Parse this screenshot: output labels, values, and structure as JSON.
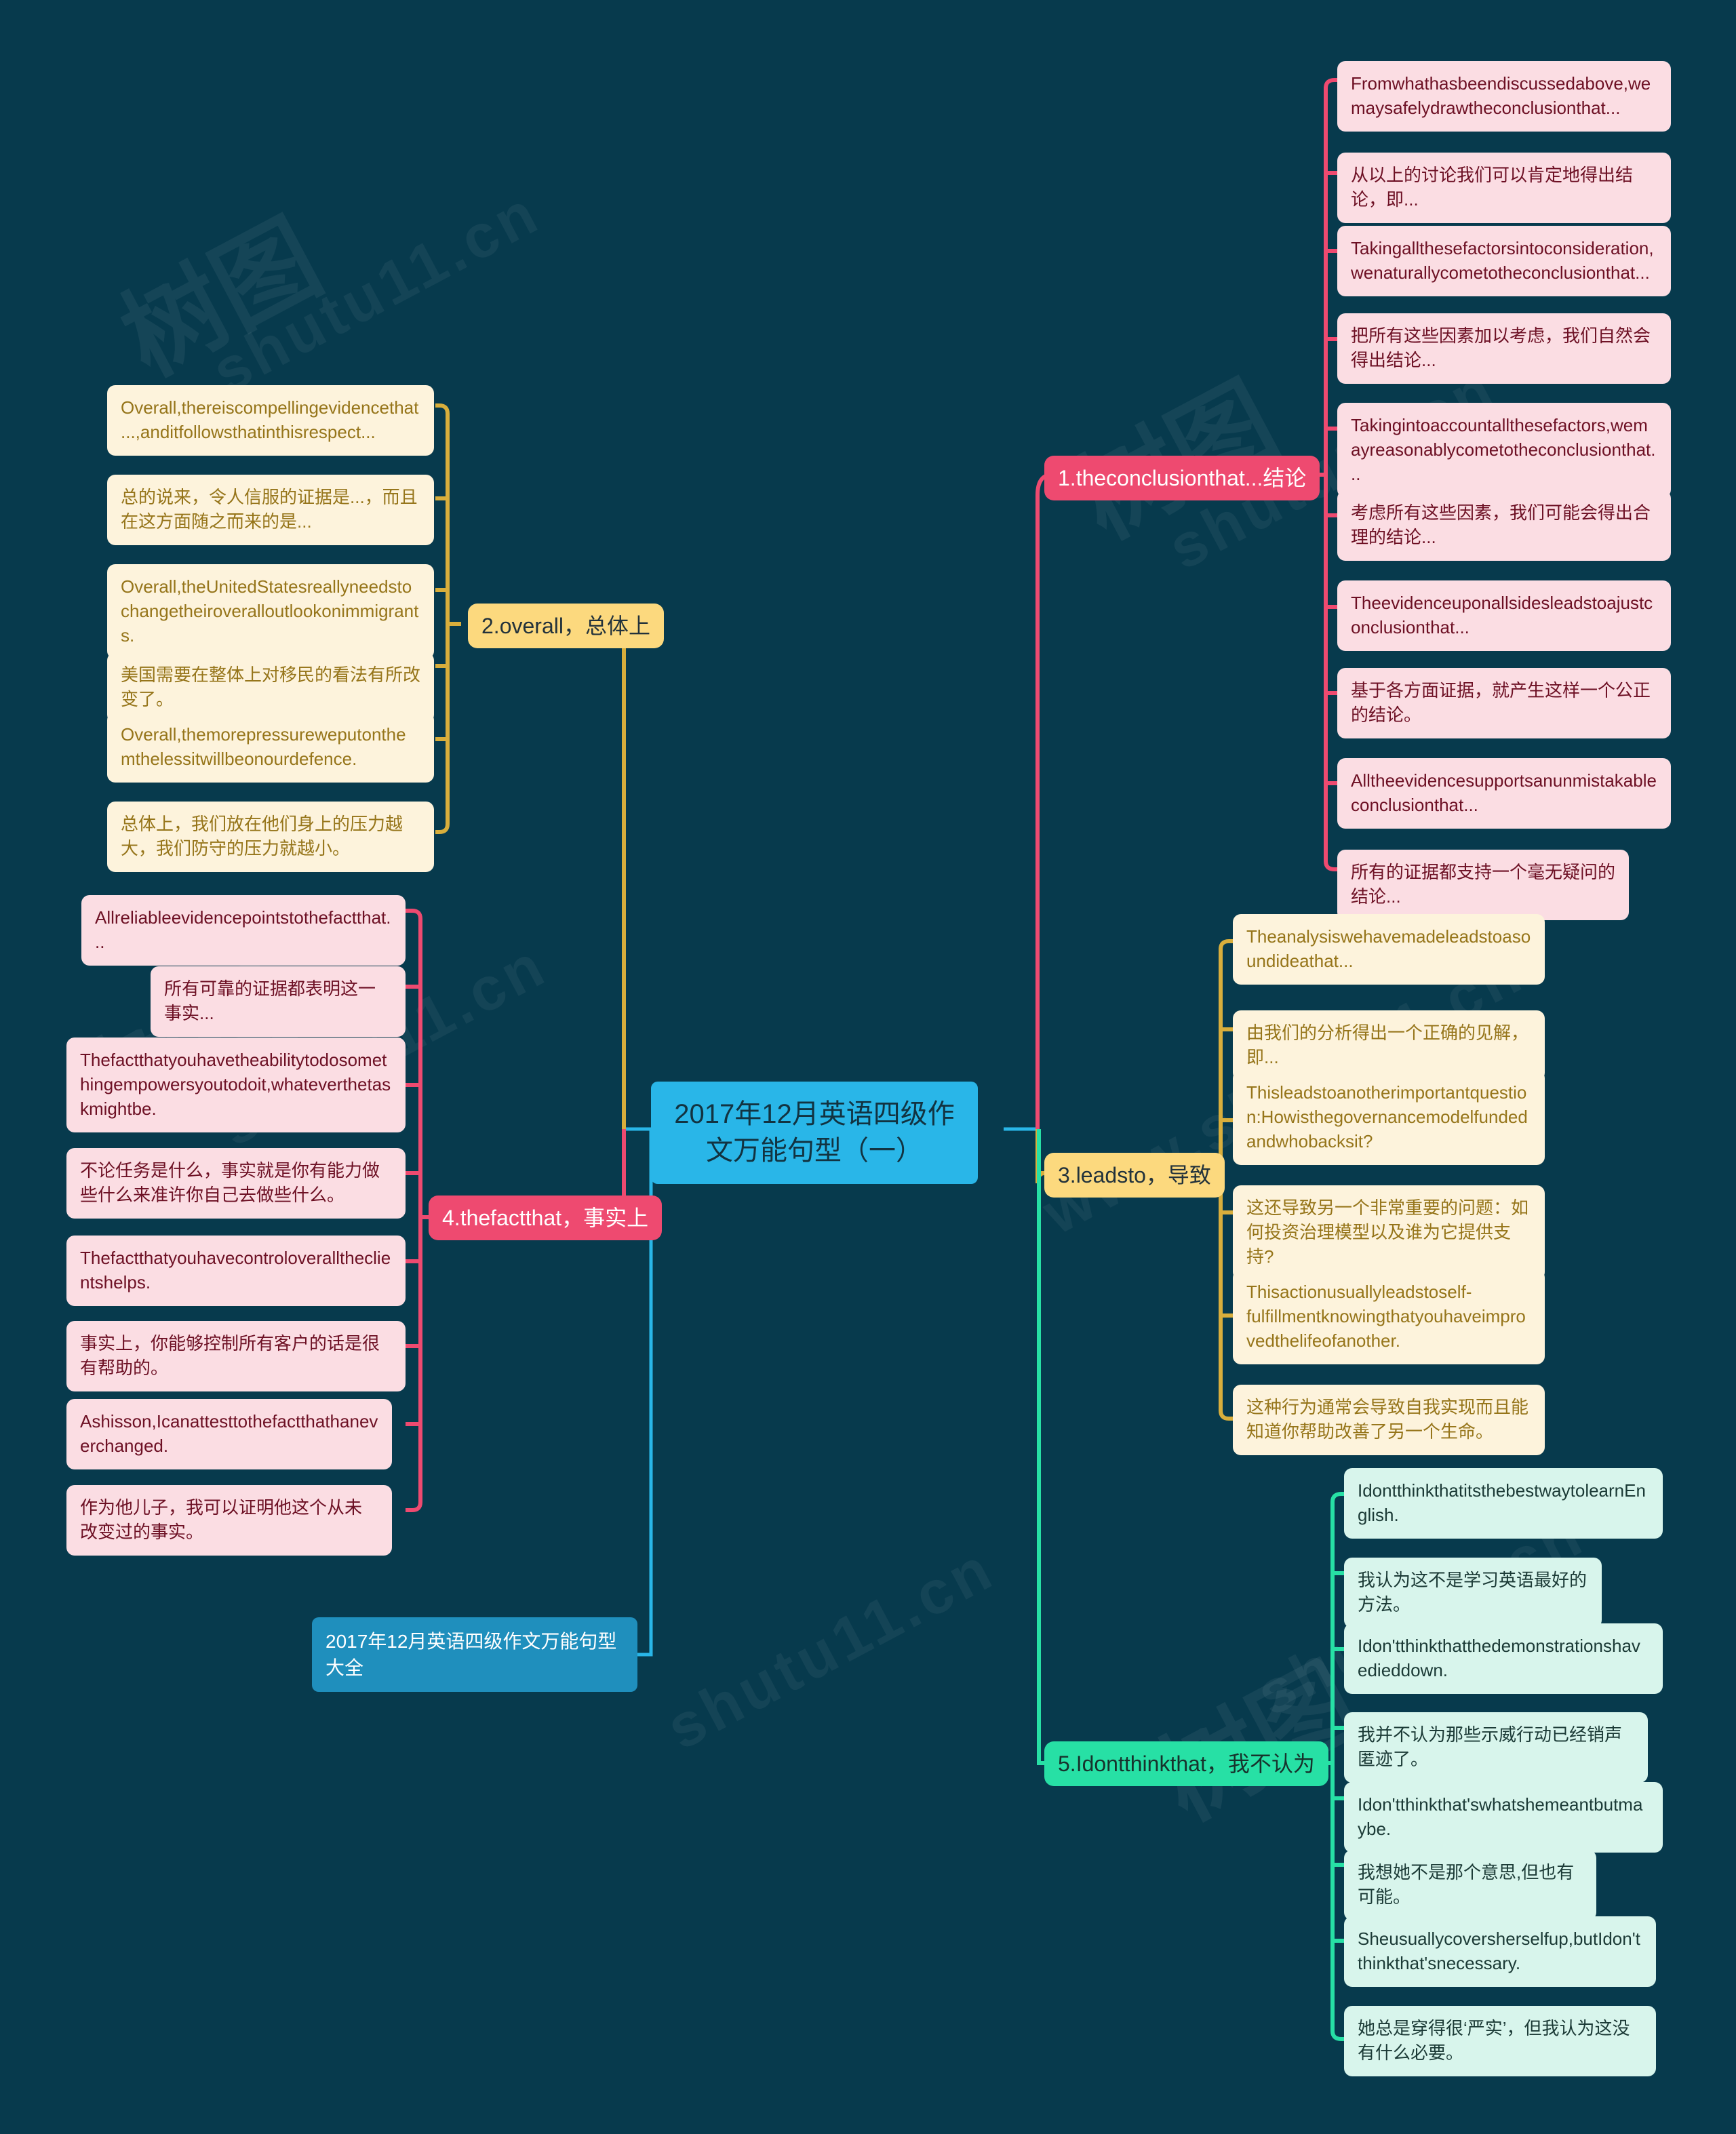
{
  "theme": {
    "background": "#073a4d",
    "center_color": "#29b6e8",
    "link_node_color": "#1f8fbd",
    "pink_branch": "#ee4a70",
    "pink_leaf_bg": "#fbdde3",
    "pink_leaf_text": "#6d1024",
    "yellow_branch": "#fcd97e",
    "yellow_leaf_bg": "#fdf3dc",
    "yellow_leaf_text": "#96751a",
    "green_branch": "#27e0a5",
    "green_leaf_bg": "#d8f5ec",
    "green_leaf_text": "#1b3a36"
  },
  "watermarks": [
    "www.shutu11.cn",
    "树图"
  ],
  "center": {
    "title": "2017年12月英语四级作文万能句型（一）"
  },
  "link_node": {
    "label": "2017年12月英语四级作文万能句型大全"
  },
  "branches": [
    {
      "id": "conclusion",
      "label": "1.theconclusionthat...结论",
      "color": "pink",
      "children": [
        "Fromwhathasbeendiscussedabove,wemaysafelydrawtheconclusionthat...",
        "从以上的讨论我们可以肯定地得出结论，即...",
        "Takingallthesefactorsintoconsideration,wenaturallycometotheconclusionthat...",
        "把所有这些因素加以考虑，我们自然会得出结论...",
        "Takingintoaccountallthesefactors,wemayreasonablycometotheconclusionthat...",
        "考虑所有这些因素，我们可能会得出合理的结论...",
        "Theevidenceuponallsidesleadstoajustconclusionthat...",
        "基于各方面证据，就产生这样一个公正的结论。",
        "Alltheevidencesupportsanunmistakableconclusionthat...",
        "所有的证据都支持一个毫无疑问的结论..."
      ]
    },
    {
      "id": "overall",
      "label": "2.overall，总体上",
      "color": "yellow",
      "children": [
        "Overall,thereiscompellingevidencethat...,anditfollowsthatinthisrespect...",
        "总的说来，令人信服的证据是...，而且在这方面随之而来的是...",
        "Overall,theUnitedStatesreallyneedstochangetheiroveralloutlookonimmigrants.",
        "美国需要在整体上对移民的看法有所改变了。",
        "Overall,themorepressureweputonthemthelessitwillbeonourdefence.",
        "总体上，我们放在他们身上的压力越大，我们防守的压力就越小。"
      ]
    },
    {
      "id": "leadsto",
      "label": "3.leadsto，导致",
      "color": "yellow",
      "children": [
        "Theanalysiswehavemadeleadstoasoundideathat...",
        "由我们的分析得出一个正确的见解，即...",
        "Thisleadstoanotherimportantquestion:Howisthegovernancemodelfundedandwhobacksit?",
        "这还导致另一个非常重要的问题：如何投资治理模型以及谁为它提供支持?",
        "Thisactionusuallyleadstoself-fulfillmentknowingthatyouhaveimprovedthelifeofanother.",
        "这种行为通常会导致自我实现而且能知道你帮助改善了另一个生命。"
      ]
    },
    {
      "id": "thefactthat",
      "label": "4.thefactthat，事实上",
      "color": "pink",
      "children": [
        "Allreliableevidencepointstothefactthat...",
        "所有可靠的证据都表明这一事实...",
        "Thefactthatyouhavetheabilitytodosomethingempowersyoutodoit,whateverthetaskmightbe.",
        "不论任务是什么，事实就是你有能力做些什么来准许你自己去做些什么。",
        "Thefactthatyouhavecontroloveralltheclientshelps.",
        "事实上，你能够控制所有客户的话是很有帮助的。",
        "Ashisson,Icanattesttothefactthathaneverchanged.",
        "作为他儿子，我可以证明他这个从未改变过的事实。"
      ]
    },
    {
      "id": "idontthinkthat",
      "label": "5.Idontthinkthat，我不认为",
      "color": "green",
      "children": [
        "IdontthinkthatitsthebestwaytolearnEnglish.",
        "我认为这不是学习英语最好的方法。",
        "Idon'tthinkthatthedemonstrationshavedieddown.",
        "我并不认为那些示威行动已经销声匿迹了。",
        "Idon'tthinkthat'swhatshemeantbutmaybe.",
        "我想她不是那个意思,但也有可能。",
        "Sheusuallycoversherselfup,butIdon'tthinkthat'snecessary.",
        "她总是穿得很‘严实’，但我认为这没有什么必要。"
      ]
    }
  ]
}
